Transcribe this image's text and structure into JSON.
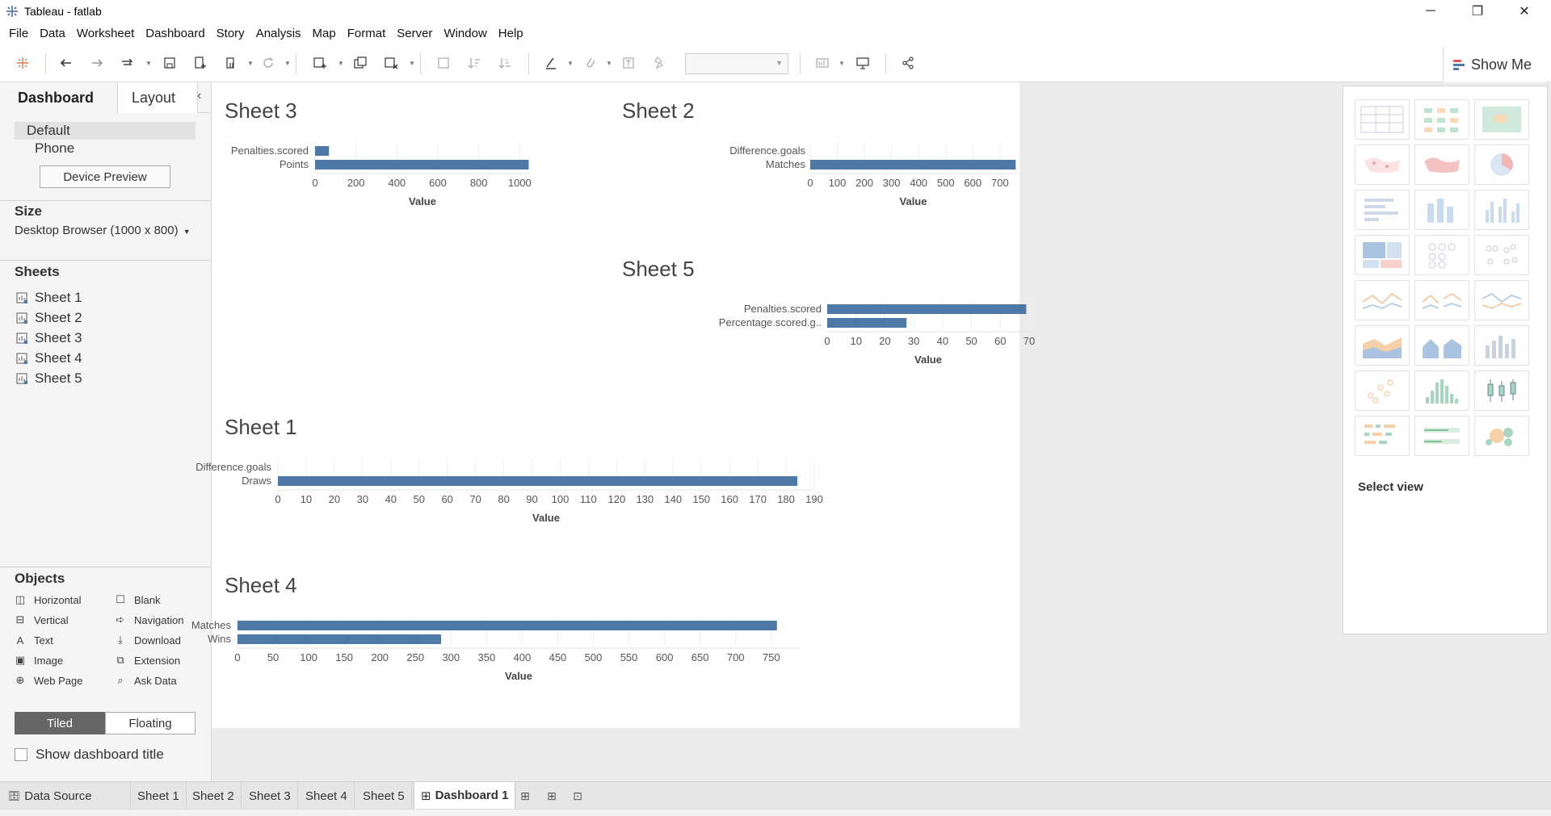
{
  "window": {
    "title": "Tableau - fatlab",
    "minimize": "─",
    "restore": "❐",
    "close": "✕"
  },
  "menu": [
    "File",
    "Data",
    "Worksheet",
    "Dashboard",
    "Story",
    "Analysis",
    "Map",
    "Format",
    "Server",
    "Window",
    "Help"
  ],
  "toolbar": {
    "show_me": "Show Me"
  },
  "left": {
    "tab_dashboard": "Dashboard",
    "tab_layout": "Layout",
    "collapse": "‹",
    "device_default": "Default",
    "device_phone": "Phone",
    "device_preview": "Device Preview",
    "size_heading": "Size",
    "size_value": "Desktop Browser (1000 x 800)",
    "sheets_heading": "Sheets",
    "sheets": [
      "Sheet 1",
      "Sheet 2",
      "Sheet 3",
      "Sheet 4",
      "Sheet 5"
    ],
    "objects_heading": "Objects",
    "objects": {
      "horizontal": "Horizontal",
      "vertical": "Vertical",
      "text": "Text",
      "image": "Image",
      "web_page": "Web Page",
      "blank": "Blank",
      "navigation": "Navigation",
      "download": "Download",
      "extension": "Extension",
      "ask_data": "Ask Data"
    },
    "tiled": "Tiled",
    "floating": "Floating",
    "show_title": "Show dashboard title"
  },
  "showme": {
    "select_view": "Select view"
  },
  "tabs": {
    "data_source": "Data Source",
    "sheets": [
      "Sheet 1",
      "Sheet 2",
      "Sheet 3",
      "Sheet 4",
      "Sheet 5"
    ],
    "dashboard": "Dashboard 1"
  },
  "colors": {
    "bar": "#4e79a7",
    "accent": "#4e79a7"
  },
  "chart_data": [
    {
      "type": "bar",
      "title": "Sheet 3",
      "orientation": "horizontal",
      "categories": [
        "Penalties.scored",
        "Points"
      ],
      "values": [
        68,
        1044
      ],
      "xlabel": "Value",
      "xlim": [
        0,
        1050
      ],
      "ticks": [
        0,
        200,
        400,
        600,
        800,
        1000
      ]
    },
    {
      "type": "bar",
      "title": "Sheet 2",
      "orientation": "horizontal",
      "categories": [
        "Difference.goals",
        "Matches"
      ],
      "values": [
        0,
        758
      ],
      "xlabel": "Value",
      "xlim": [
        0,
        760
      ],
      "ticks": [
        0,
        100,
        200,
        300,
        400,
        500,
        600,
        700
      ]
    },
    {
      "type": "bar",
      "title": "Sheet 5",
      "orientation": "horizontal",
      "categories": [
        "Penalties.scored",
        "Percentage.scored.g.."
      ],
      "values": [
        69,
        27.5
      ],
      "xlabel": "Value",
      "xlim": [
        0,
        70
      ],
      "ticks": [
        0,
        10,
        20,
        30,
        40,
        50,
        60,
        70
      ]
    },
    {
      "type": "bar",
      "title": "Sheet 1",
      "orientation": "horizontal",
      "categories": [
        "Difference.goals",
        "Draws"
      ],
      "values": [
        0,
        184
      ],
      "xlabel": "Value",
      "xlim": [
        0,
        190
      ],
      "ticks": [
        0,
        10,
        20,
        30,
        40,
        50,
        60,
        70,
        80,
        90,
        100,
        110,
        120,
        130,
        140,
        150,
        160,
        170,
        180,
        190
      ]
    },
    {
      "type": "bar",
      "title": "Sheet 4",
      "orientation": "horizontal",
      "categories": [
        "Matches",
        "Wins"
      ],
      "values": [
        758,
        286
      ],
      "xlabel": "Value",
      "xlim": [
        0,
        790
      ],
      "ticks": [
        0,
        50,
        100,
        150,
        200,
        250,
        300,
        350,
        400,
        450,
        500,
        550,
        600,
        650,
        700,
        750
      ]
    }
  ]
}
